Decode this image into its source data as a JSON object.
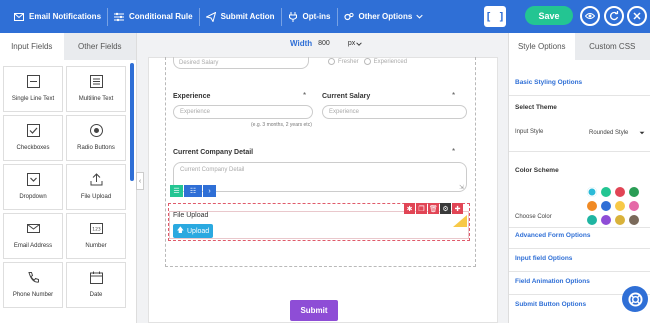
{
  "toolbar": {
    "email_notifications": "Email Notifications",
    "conditional_rule": "Conditional Rule",
    "submit_action": "Submit Action",
    "opt_ins": "Opt-ins",
    "other_options": "Other Options",
    "bracket_button": "[ ]",
    "save": "Save"
  },
  "left_panel": {
    "tabs": [
      "Input Fields",
      "Other Fields"
    ],
    "fields": [
      {
        "label": "Single Line Text",
        "icon": "single-line-text-icon"
      },
      {
        "label": "Multiline Text",
        "icon": "multiline-text-icon"
      },
      {
        "label": "Checkboxes",
        "icon": "checkbox-icon"
      },
      {
        "label": "Radio Buttons",
        "icon": "radio-icon"
      },
      {
        "label": "Dropdown",
        "icon": "dropdown-icon"
      },
      {
        "label": "File Upload",
        "icon": "upload-icon"
      },
      {
        "label": "Email Address",
        "icon": "envelope-icon"
      },
      {
        "label": "Number",
        "icon": "number-icon"
      },
      {
        "label": "Phone Number",
        "icon": "phone-icon"
      },
      {
        "label": "Date",
        "icon": "calendar-icon"
      }
    ]
  },
  "canvas": {
    "width_label": "Width",
    "width_value": "800",
    "width_unit": "px",
    "desired_salary_placeholder": "Desired Salary",
    "radio_fresher": "Fresher",
    "radio_experienced": "Experienced",
    "experience_label": "Experience",
    "experience_placeholder": "Experience",
    "experience_hint": "(e.g. 3 months, 2 years etc)",
    "current_salary_label": "Current Salary",
    "current_salary_placeholder": "Experience",
    "company_detail_label": "Current Company Detail",
    "company_detail_placeholder": "Current Company Detail",
    "file_upload_label": "File Upload",
    "upload_button": "Upload",
    "submit_button": "Submit",
    "required_mark": "*"
  },
  "right_panel": {
    "tabs": [
      "Style Options",
      "Custom CSS"
    ],
    "basic_styling": "Basic Styling Options",
    "select_theme": "Select Theme",
    "input_style_label": "Input Style",
    "input_style_value": "Rounded Style",
    "color_scheme": "Color Scheme",
    "choose_color": "Choose Color",
    "advanced_form": "Advanced Form Options",
    "input_field_options": "Input field Options",
    "field_animation": "Field Animation Options",
    "submit_button_options": "Submit Button Options",
    "swatch_colors": [
      "#2bbbd8",
      "#23c592",
      "#e14555",
      "#2a9d55",
      "#f08a24",
      "#2f6fd6",
      "#f7c948",
      "#e56aa8",
      "#1fb5a2",
      "#8e4dd6",
      "#d9b23a",
      "#7a6a5a"
    ]
  }
}
